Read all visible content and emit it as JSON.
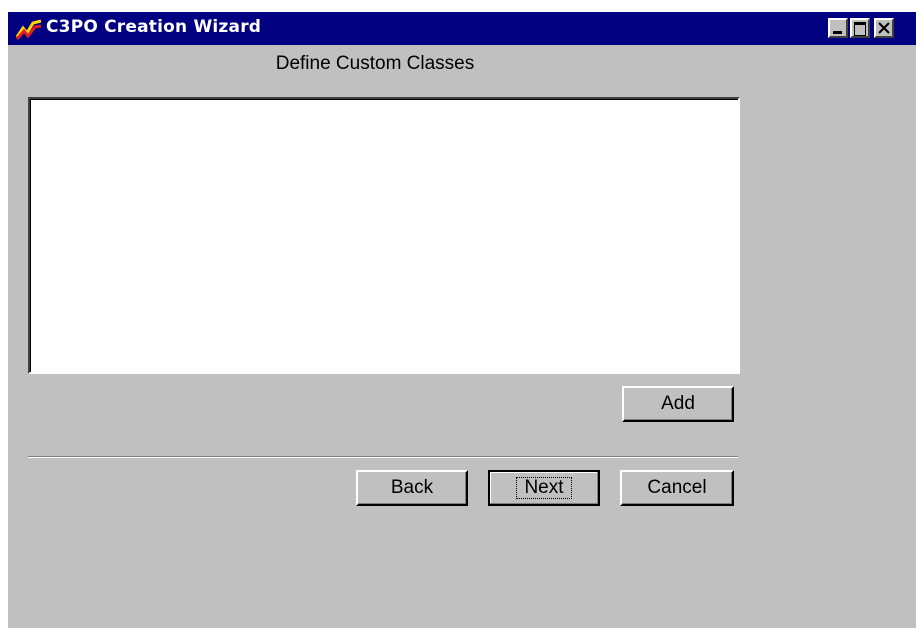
{
  "window": {
    "title": "C3PO Creation Wizard",
    "controls": {
      "minimize": "minimize-icon",
      "maximize": "maximize-icon",
      "close": "close-icon"
    },
    "colors": {
      "titlebar": "#000080",
      "face": "#c0c0c0"
    }
  },
  "page": {
    "heading": "Define Custom Classes",
    "classes_list": []
  },
  "buttons": {
    "add": "Add",
    "back": "Back",
    "next": "Next",
    "cancel": "Cancel"
  }
}
